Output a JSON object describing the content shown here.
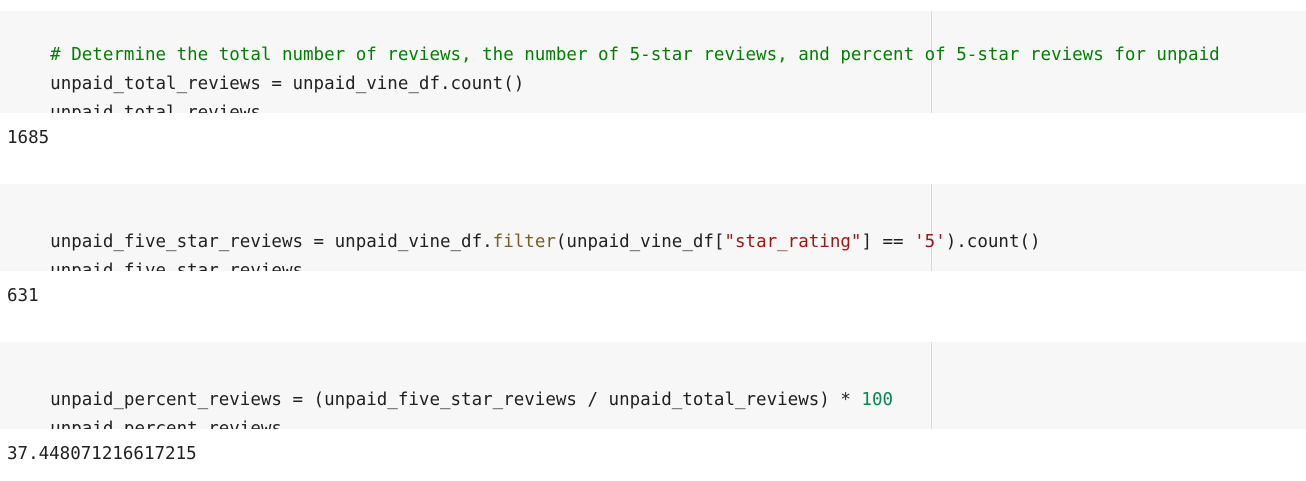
{
  "cells": [
    {
      "code": [
        [
          {
            "t": "# Determine the total number of reviews, the number of 5-star reviews, and percent of 5-star reviews for unpaid",
            "c": "comment"
          }
        ],
        [
          {
            "t": "unpaid_total_reviews = unpaid_vine_df.count()",
            "c": "plain"
          }
        ],
        [
          {
            "t": "unpaid_total_reviews",
            "c": "plain"
          }
        ]
      ],
      "output": "1685"
    },
    {
      "code": [
        [
          {
            "t": "unpaid_five_star_reviews = unpaid_vine_df.",
            "c": "plain"
          },
          {
            "t": "filter",
            "c": "fn"
          },
          {
            "t": "(unpaid_vine_df[",
            "c": "plain"
          },
          {
            "t": "\"star_rating\"",
            "c": "str"
          },
          {
            "t": "] == ",
            "c": "plain"
          },
          {
            "t": "'5'",
            "c": "str"
          },
          {
            "t": ").count()",
            "c": "plain"
          }
        ],
        [
          {
            "t": "unpaid_five_star_reviews",
            "c": "plain"
          }
        ]
      ],
      "output": "631"
    },
    {
      "code": [
        [
          {
            "t": "unpaid_percent_reviews = (unpaid_five_star_reviews / unpaid_total_reviews) * ",
            "c": "plain"
          },
          {
            "t": "100",
            "c": "num"
          }
        ],
        [
          {
            "t": "unpaid_percent_reviews",
            "c": "plain"
          }
        ]
      ],
      "output": "37.448071216617215"
    }
  ],
  "colors": {
    "cell_background": "#f7f7f7",
    "comment": "#008000",
    "string": "#a31515",
    "function": "#795e26",
    "number": "#098658",
    "text": "#212121"
  }
}
